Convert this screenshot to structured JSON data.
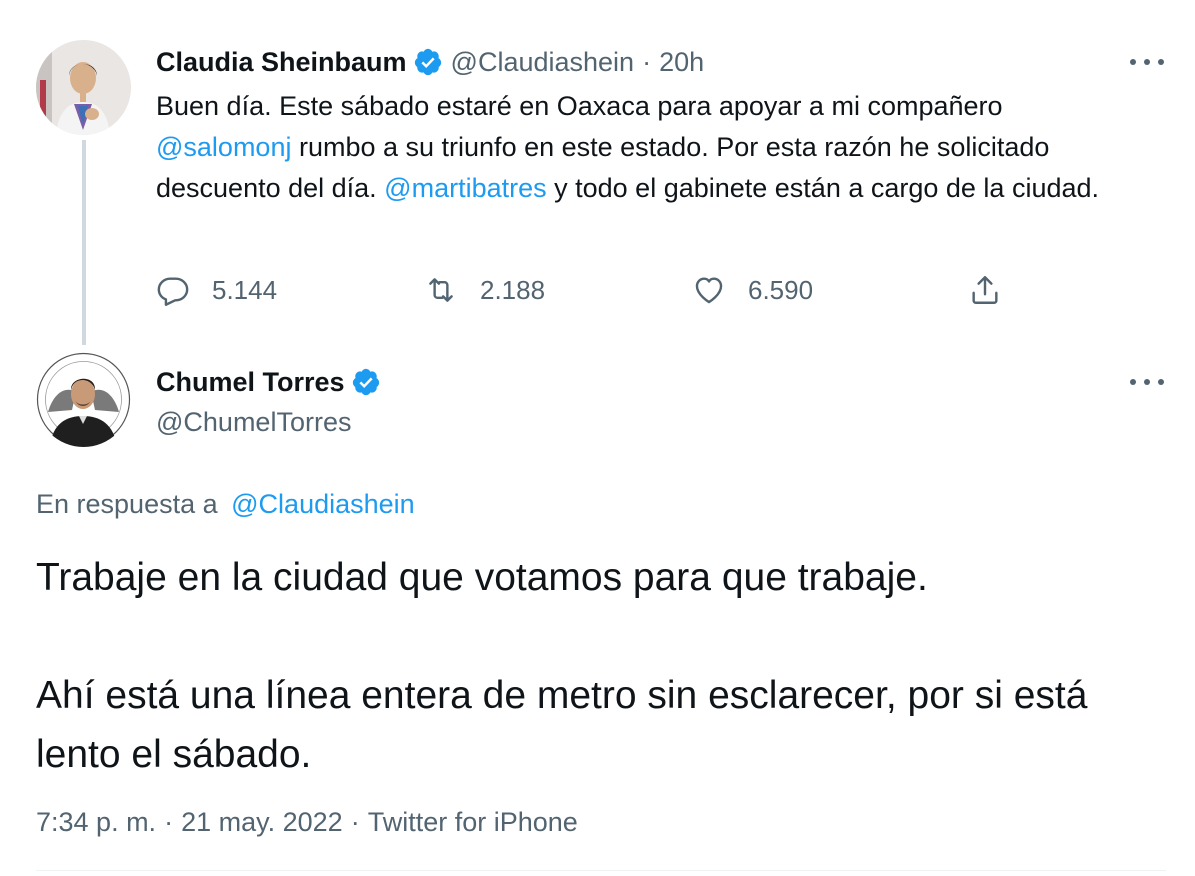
{
  "tweet1": {
    "name": "Claudia Sheinbaum",
    "handle": "@Claudiashein",
    "separator": "·",
    "time": "20h",
    "body": {
      "part1": "Buen día. Este sábado estaré en Oaxaca para apoyar a mi compañero",
      "mention1": "@salomonj",
      "part2": " rumbo a su triunfo en este estado. Por esta razón he solicitado descuento del día. ",
      "mention2": "@martibatres",
      "part3": " y todo el gabinete están a cargo de la ciudad."
    },
    "replies": "5.144",
    "retweets": "2.188",
    "likes": "6.590"
  },
  "tweet2": {
    "name": "Chumel Torres",
    "handle": "@ChumelTorres",
    "reply_prefix": "En respuesta a",
    "reply_handle": "@Claudiashein",
    "paragraph1": "Trabaje en la ciudad que votamos para que trabaje.",
    "paragraph2": "Ahí está una línea entera de metro sin esclarecer, por si está lento el sábado.",
    "time": "7:34 p. m.",
    "date": "21 may. 2022",
    "source": "Twitter for iPhone",
    "separator": "·"
  },
  "icons": {
    "verified": "verified-badge-icon",
    "more": "more-icon",
    "reply": "reply-icon",
    "retweet": "retweet-icon",
    "like": "heart-icon",
    "share": "share-icon"
  },
  "colors": {
    "accent": "#1d9bf0",
    "secondary_text": "#536471",
    "primary_text": "#0f1419",
    "thread_line": "#cfd9de"
  }
}
